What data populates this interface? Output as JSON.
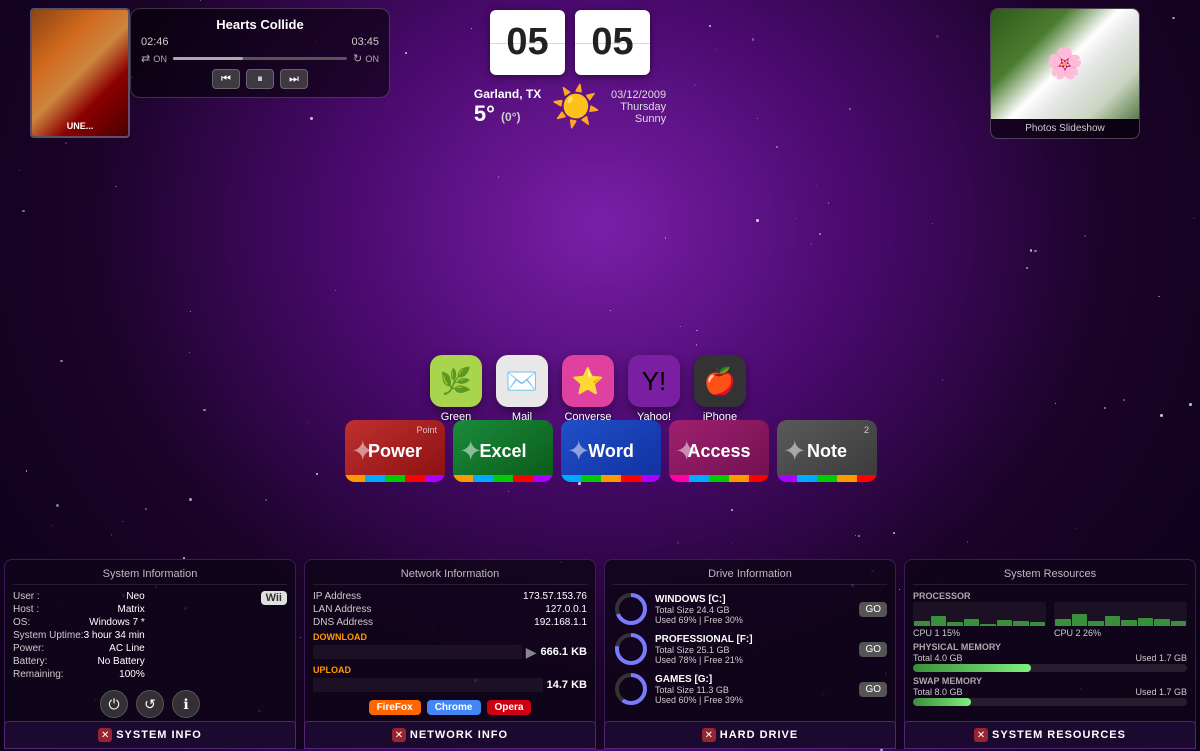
{
  "background": {
    "color_primary": "#7a1fa8",
    "color_secondary": "#1a0328"
  },
  "music_widget": {
    "title": "Hearts Collide",
    "time_current": "02:46",
    "time_total": "03:45",
    "shuffle_label": "ON",
    "repeat_label": "ON",
    "btn_prev": "⏮",
    "btn_play": "⏸",
    "btn_next": "⏭",
    "album_text": "UNE..."
  },
  "clock": {
    "hour": "05",
    "minute": "05",
    "location": "Garland, TX",
    "date": "03/12/2009",
    "day": "Thursday",
    "temp": "5°",
    "temp_sub": "(0°)",
    "condition": "Sunny"
  },
  "photos": {
    "label": "Photos Slideshow"
  },
  "app_icons": [
    {
      "id": "green",
      "label": "Green",
      "emoji": "🌿",
      "bg": "#a8d44e"
    },
    {
      "id": "mail",
      "label": "Mail",
      "emoji": "✉️",
      "bg": "#e8e8e8"
    },
    {
      "id": "converse",
      "label": "Converse",
      "emoji": "⭐",
      "bg": "#e040a0"
    },
    {
      "id": "yahoo",
      "label": "Yahoo!",
      "emoji": "Y!",
      "bg": "#7b1fa2"
    },
    {
      "id": "iphone",
      "label": "iPhone",
      "emoji": "🍎",
      "bg": "#333"
    }
  ],
  "office_icons": [
    {
      "id": "power",
      "label": "Power",
      "sub": "Point",
      "color_bg": "#b03030",
      "ribbon_colors": [
        "#f90",
        "#0af",
        "#0c0",
        "#f00",
        "#a0f"
      ]
    },
    {
      "id": "excel",
      "label": "Excel",
      "sub": "",
      "color_bg": "#1a6b2a",
      "ribbon_colors": [
        "#f90",
        "#0af",
        "#0c0",
        "#f00",
        "#a0f"
      ]
    },
    {
      "id": "word",
      "label": "Word",
      "sub": "",
      "color_bg": "#1a3fa8",
      "ribbon_colors": [
        "#0af",
        "#0c0",
        "#f90",
        "#f00",
        "#a0f"
      ]
    },
    {
      "id": "access",
      "label": "Access",
      "sub": "",
      "color_bg": "#8b1a5e",
      "ribbon_colors": [
        "#f0a",
        "#0af",
        "#0c0",
        "#f90",
        "#f00"
      ]
    },
    {
      "id": "note",
      "label": "Note",
      "sub": "2",
      "color_bg": "#4a4a4a",
      "ribbon_colors": [
        "#a0f",
        "#0af",
        "#0c0",
        "#f90",
        "#f00"
      ]
    }
  ],
  "system_info": {
    "title": "System Information",
    "user": "Neo",
    "host": "Matrix",
    "os": "Windows 7 *",
    "uptime": "3 hour 34 min",
    "power": "AC Line",
    "battery": "No Battery",
    "remaining": "100%",
    "badge": "Wii",
    "btn_power": "⏻",
    "btn_refresh": "↺",
    "btn_info": "ℹ"
  },
  "network_info": {
    "title": "Network Information",
    "ip_label": "IP Address",
    "ip_val": "173.57.153.76",
    "lan_label": "LAN Address",
    "lan_val": "127.0.0.1",
    "dns_label": "DNS Address",
    "dns_val": "192.168.1.1",
    "download_label": "DOWNLOAD",
    "download_val": "666.1 KB",
    "upload_label": "UPLOAD",
    "upload_val": "14.7 KB",
    "browsers": [
      "FireFox",
      "Chrome",
      "Opera"
    ]
  },
  "drive_info": {
    "title": "Drive Information",
    "drives": [
      {
        "name": "WINDOWS [C:]",
        "total": "Total Size  24.4 GB",
        "used": "Used 69%",
        "free": "Free 30%",
        "used_pct": 69
      },
      {
        "name": "PROFESSIONAL [F:]",
        "total": "Total Size  25.1 GB",
        "used": "Used 78%",
        "free": "Free 21%",
        "used_pct": 78
      },
      {
        "name": "GAMES [G:]",
        "total": "Total Size  11.3 GB",
        "used": "Used 60%",
        "free": "Free 39%",
        "used_pct": 60
      }
    ]
  },
  "system_resources": {
    "title": "System Resources",
    "processor_label": "PROCESSOR",
    "cpu1_label": "CPU 1",
    "cpu1_pct": "15%",
    "cpu2_label": "CPU 2",
    "cpu2_pct": "26%",
    "physical_label": "PHYSICAL MEMORY",
    "physical_total": "Total 4.0 GB",
    "physical_used": "Used 1.7 GB",
    "physical_pct": 43,
    "swap_label": "SWAP MEMORY",
    "swap_total": "Total 8.0 GB",
    "swap_used": "Used 1.7 GB",
    "swap_pct": 21
  },
  "footer": {
    "items": [
      "SYSTEM INFO",
      "NETWORK INFO",
      "HARD DRIVE",
      "SYSTEM RESOURCES"
    ]
  }
}
